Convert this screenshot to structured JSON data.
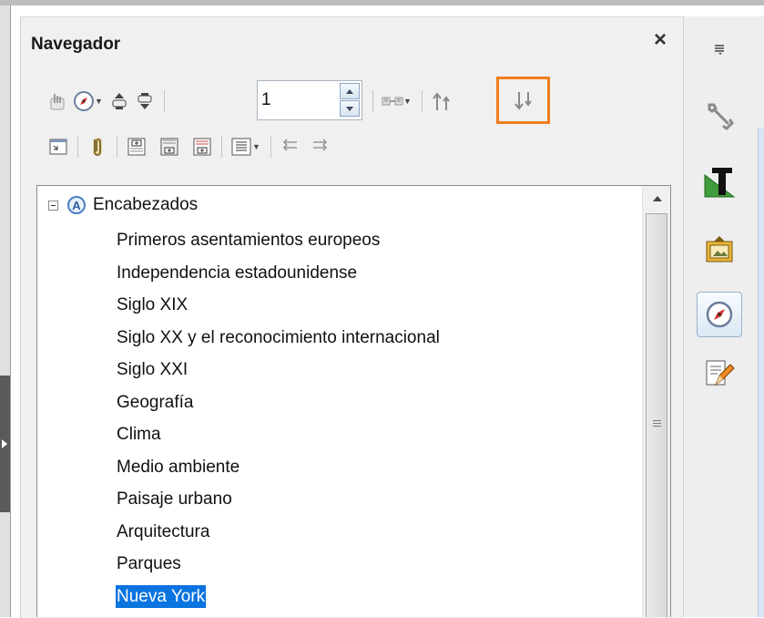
{
  "navigator": {
    "title": "Navegador",
    "close_symbol": "×",
    "toolbar": {
      "spin_value": "1"
    },
    "tree": {
      "root_label": "Encabezados",
      "root_icon": "headings-icon",
      "items": [
        "Primeros asentamientos europeos",
        "Independencia estadounidense",
        "Siglo XIX",
        "Siglo XX y el reconocimiento internacional",
        "Siglo XXI",
        "Geografía",
        "Clima",
        "Medio ambiente",
        "Paisaje urbano",
        "Arquitectura",
        "Parques",
        "Nueva York"
      ],
      "selected_index": 11
    },
    "highlight_color": "#f07c1e",
    "selection_color": "#0a74e0"
  },
  "sidebar": {
    "buttons": [
      "sidebar-menu-icon",
      "properties-wrench-icon",
      "styles-formatting-icon",
      "gallery-icon",
      "navigator-compass-icon",
      "manage-changes-icon"
    ],
    "active": "navigator-compass-icon"
  }
}
